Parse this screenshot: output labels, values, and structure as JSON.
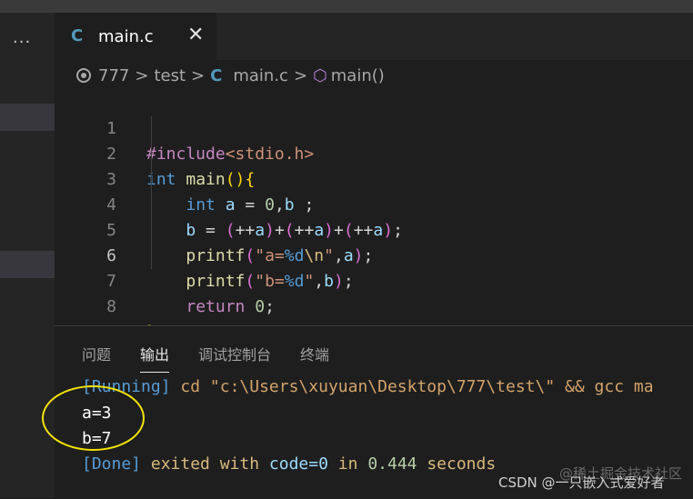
{
  "sidebar": {
    "more_label": "···"
  },
  "tab": {
    "lang_icon": "C",
    "file_name": "main.c",
    "close_label": "✕"
  },
  "breadcrumb": {
    "folder1": "777",
    "folder2": "test",
    "lang_icon": "C",
    "file": "main.c",
    "symbol": "main()",
    "separator": ">"
  },
  "editor": {
    "active_line": 6,
    "lines": [
      {
        "n": "1"
      },
      {
        "n": "2"
      },
      {
        "n": "3"
      },
      {
        "n": "4"
      },
      {
        "n": "5"
      },
      {
        "n": "6"
      },
      {
        "n": "7"
      },
      {
        "n": "8"
      }
    ]
  },
  "panel": {
    "tabs": [
      "问题",
      "输出",
      "调试控制台",
      "终端"
    ],
    "active_tab": "输出",
    "output": {
      "running_tag": "[Running]",
      "running_cmd": " cd \"c:\\Users\\xuyuan\\Desktop\\777\\test\\\" && gcc ma",
      "result_a": "a=3",
      "result_b": "b=7",
      "done_tag": "[Done]",
      "done_exited": " exited with ",
      "done_code": "code=0",
      "done_in": " in ",
      "done_time": "0.444",
      "done_seconds": " seconds"
    }
  },
  "watermark": {
    "text": "CSDN @一只嵌入式爱好者",
    "faint_text": "@稀土掘金技术社区"
  },
  "colors": {
    "accent_ellipse": "#f5e400",
    "keyword": "#569cd6",
    "string": "#ce9178",
    "function": "#dcdcaa"
  }
}
